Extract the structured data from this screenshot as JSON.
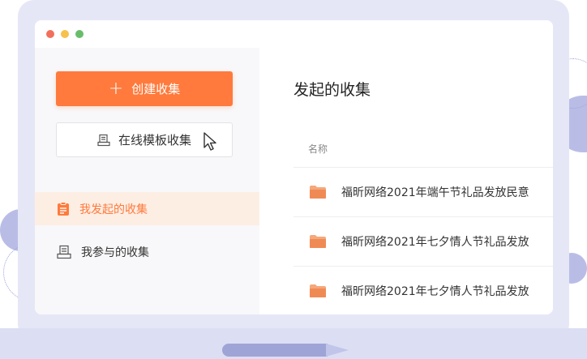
{
  "window": {
    "controls": [
      "close",
      "minimize",
      "maximize"
    ],
    "control_colors": [
      "#f2705b",
      "#f6c14d",
      "#69bd6a"
    ]
  },
  "sidebar": {
    "create_button": {
      "icon": "plus-icon",
      "label": "创建收集"
    },
    "template_button": {
      "icon": "template-icon",
      "label": "在线模板收集"
    },
    "nav": [
      {
        "icon": "clipboard-icon",
        "label": "我发起的收集",
        "active": true
      },
      {
        "icon": "printer-icon",
        "label": "我参与的收集",
        "active": false
      }
    ]
  },
  "main": {
    "title": "发起的收集",
    "column_header": "名称",
    "rows": [
      {
        "icon": "folder-icon",
        "name": "福昕网络2021年端午节礼品发放民意"
      },
      {
        "icon": "folder-icon",
        "name": "福昕网络2021年七夕情人节礼品发放"
      },
      {
        "icon": "folder-icon",
        "name": "福昕网络2021年七夕情人节礼品发放"
      }
    ]
  },
  "colors": {
    "accent": "#ff7a3c",
    "active_bg": "#fdeee4",
    "laptop": "#e6e7f6"
  }
}
